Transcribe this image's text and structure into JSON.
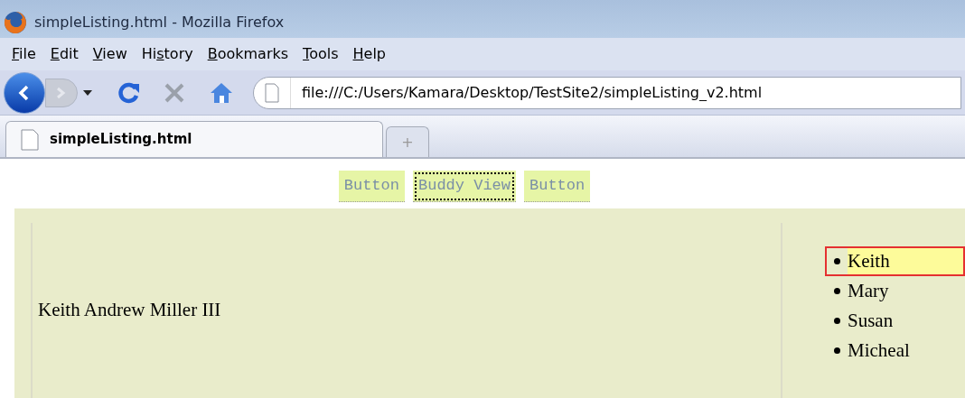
{
  "window": {
    "title": "simpleListing.html - Mozilla Firefox"
  },
  "menu": [
    {
      "key": "F",
      "after": "ile"
    },
    {
      "key": "E",
      "after": "dit"
    },
    {
      "key": "V",
      "after": "iew"
    },
    {
      "before": "Hi",
      "key": "s",
      "after": "tory"
    },
    {
      "key": "B",
      "after": "ookmarks"
    },
    {
      "key": "T",
      "after": "ools"
    },
    {
      "key": "H",
      "after": "elp"
    }
  ],
  "address": {
    "value": "file:///C:/Users/Kamara/Desktop/TestSite2/simpleListing_v2.html"
  },
  "tabs": [
    {
      "label": "simpleListing.html",
      "selected": true
    }
  ],
  "new_tab": "+",
  "buttons": [
    {
      "label": "Button",
      "focused": false
    },
    {
      "label": "Buddy View",
      "focused": true
    },
    {
      "label": "Button",
      "focused": false
    }
  ],
  "detail": "Keith Andrew Miller III",
  "list": [
    {
      "name": "Keith",
      "selected": true
    },
    {
      "name": "Mary",
      "selected": false
    },
    {
      "name": "Susan",
      "selected": false
    },
    {
      "name": "Micheal",
      "selected": false
    }
  ]
}
